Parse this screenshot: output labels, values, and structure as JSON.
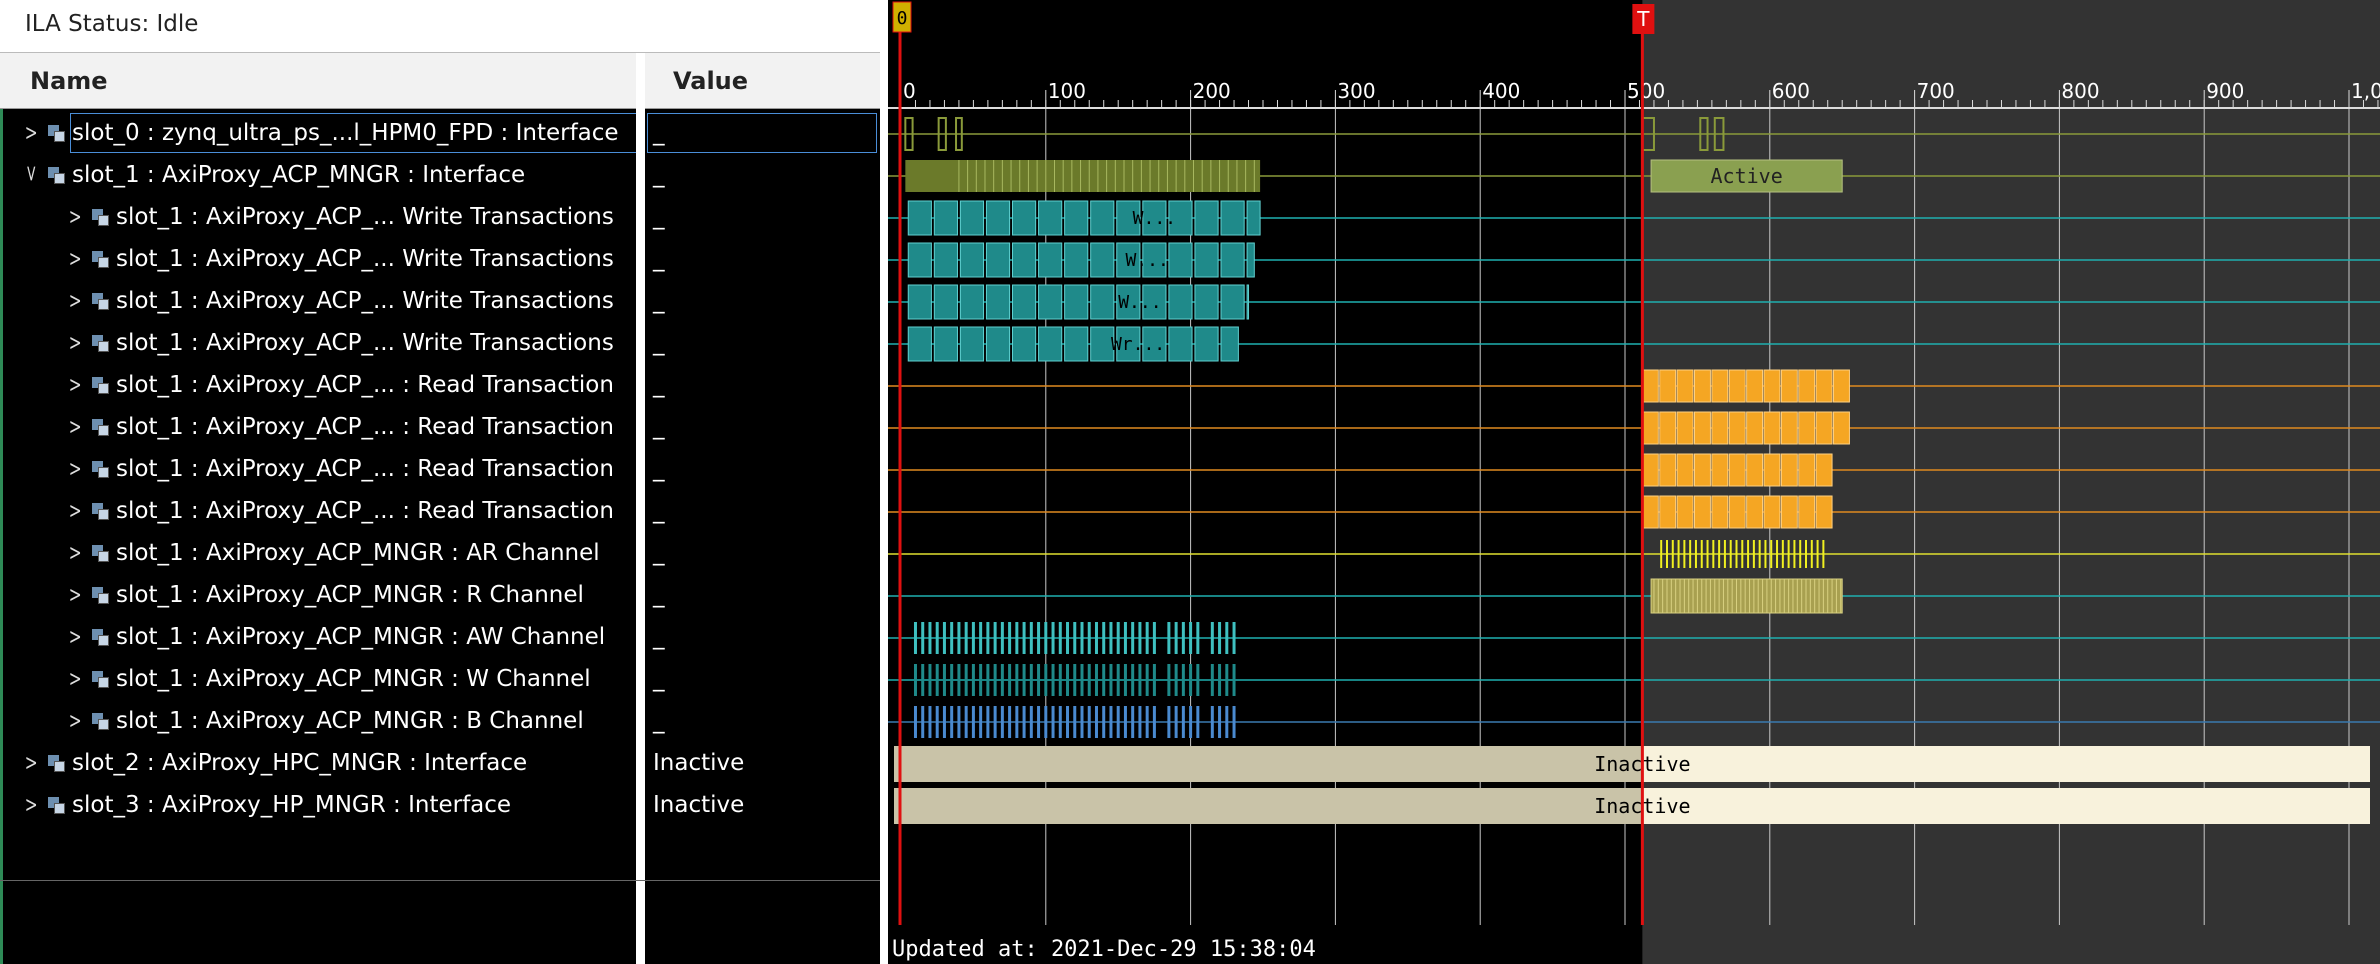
{
  "status": {
    "label": "ILA Status: Idle"
  },
  "columns": {
    "name": "Name",
    "value": "Value"
  },
  "rows": [
    {
      "name": "slot_0 : zynq_ultra_ps_...l_HPM0_FPD : Interface",
      "value": "_",
      "level": 0,
      "expanded": false
    },
    {
      "name": "slot_1 : AxiProxy_ACP_MNGR : Interface",
      "value": "_",
      "level": 0,
      "expanded": true
    },
    {
      "name": "slot_1 : AxiProxy_ACP_... Write Transactions",
      "value": "_",
      "level": 1,
      "expanded": false
    },
    {
      "name": "slot_1 : AxiProxy_ACP_... Write Transactions",
      "value": "_",
      "level": 1,
      "expanded": false
    },
    {
      "name": "slot_1 : AxiProxy_ACP_... Write Transactions",
      "value": "_",
      "level": 1,
      "expanded": false
    },
    {
      "name": "slot_1 : AxiProxy_ACP_... Write Transactions",
      "value": "_",
      "level": 1,
      "expanded": false
    },
    {
      "name": "slot_1 : AxiProxy_ACP_... : Read Transaction",
      "value": "_",
      "level": 1,
      "expanded": false
    },
    {
      "name": "slot_1 : AxiProxy_ACP_... : Read Transaction",
      "value": "_",
      "level": 1,
      "expanded": false
    },
    {
      "name": "slot_1 : AxiProxy_ACP_... : Read Transaction",
      "value": "_",
      "level": 1,
      "expanded": false
    },
    {
      "name": "slot_1 : AxiProxy_ACP_... : Read Transaction",
      "value": "_",
      "level": 1,
      "expanded": false
    },
    {
      "name": "slot_1 : AxiProxy_ACP_MNGR : AR Channel",
      "value": "_",
      "level": 1,
      "expanded": false
    },
    {
      "name": "slot_1 : AxiProxy_ACP_MNGR : R Channel",
      "value": "_",
      "level": 1,
      "expanded": false
    },
    {
      "name": "slot_1 : AxiProxy_ACP_MNGR : AW Channel",
      "value": "_",
      "level": 1,
      "expanded": false
    },
    {
      "name": "slot_1 : AxiProxy_ACP_MNGR : W Channel",
      "value": "_",
      "level": 1,
      "expanded": false
    },
    {
      "name": "slot_1 : AxiProxy_ACP_MNGR : B Channel",
      "value": "_",
      "level": 1,
      "expanded": false
    },
    {
      "name": "slot_2 : AxiProxy_HPC_MNGR : Interface",
      "value": "Inactive",
      "level": 0,
      "expanded": false
    },
    {
      "name": "slot_3 : AxiProxy_HP_MNGR : Interface",
      "value": "Inactive",
      "level": 0,
      "expanded": false
    }
  ],
  "ruler": {
    "ticks": [
      "0",
      "100",
      "200",
      "300",
      "400",
      "500",
      "600",
      "700",
      "800",
      "900",
      "1,0"
    ]
  },
  "markers": {
    "cursor_label": "0",
    "trigger_label": "T",
    "cursor_sample": 0,
    "trigger_sample": 512
  },
  "wave_labels": {
    "active": "Active",
    "inactive1": "Inactive",
    "inactive2": "Inactive",
    "w1": "W...",
    "w2": "W...",
    "w3": "W...",
    "w4": "Wr..."
  },
  "footer": {
    "updated": "Updated at: 2021-Dec-29 15:38:04"
  },
  "colors": {
    "olive": "#6b7a2a",
    "teal": "#1f8a8a",
    "orange": "#f5a623",
    "yellow": "#f0f020",
    "inactive": "#c9c3a8",
    "cursor": "#e01010",
    "grid": "#c8c8c8"
  }
}
